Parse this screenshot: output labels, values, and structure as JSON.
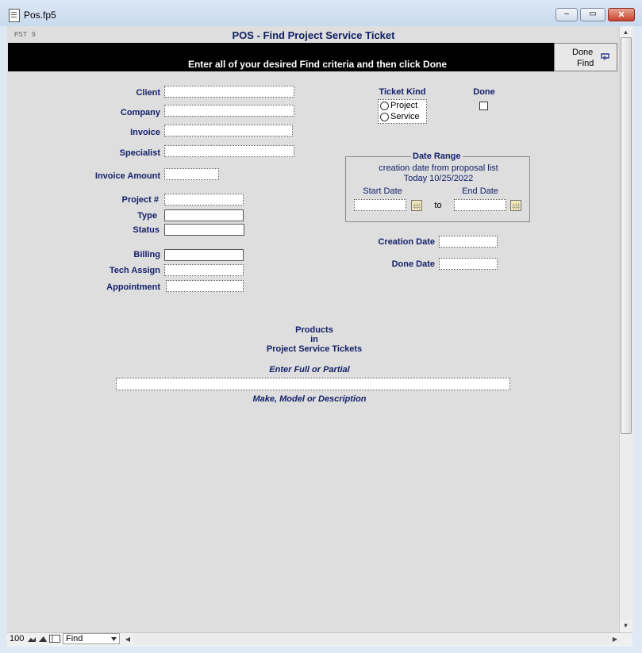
{
  "window": {
    "title": "Pos.fp5",
    "min_label": "▭",
    "max_label": "□",
    "close_label": "✕"
  },
  "layout": {
    "number": "PST 9",
    "title": "POS - Find Project Service Ticket"
  },
  "banner": {
    "instruction": "Enter all of your desired Find criteria and then click Done"
  },
  "done_find": {
    "line1": "Done",
    "line2": "Find"
  },
  "fields": {
    "client": "Client",
    "company": "Company",
    "invoice": "Invoice",
    "specialist": "Specialist",
    "invoice_amount": "Invoice Amount",
    "project_num": "Project #",
    "type": "Type",
    "status": "Status",
    "billing": "Billing",
    "tech_assign": "Tech Assign",
    "appointment": "Appointment"
  },
  "ticket_kind": {
    "label": "Ticket Kind",
    "options": [
      "Project",
      "Service"
    ]
  },
  "done_check": {
    "label": "Done"
  },
  "date_range": {
    "title": "Date Range",
    "desc1": "creation date from proposal list",
    "desc2": "Today 10/25/2022",
    "start_label": "Start Date",
    "end_label": "End Date",
    "to_label": "to"
  },
  "creation_date": "Creation Date",
  "done_date": "Done Date",
  "products": {
    "line1": "Products",
    "line2": "in",
    "line3": "Project Service Tickets",
    "hint_top": "Enter Full or Partial",
    "hint_bottom": "Make, Model or Description"
  },
  "statusbar": {
    "zoom": "100",
    "mode": "Find"
  }
}
